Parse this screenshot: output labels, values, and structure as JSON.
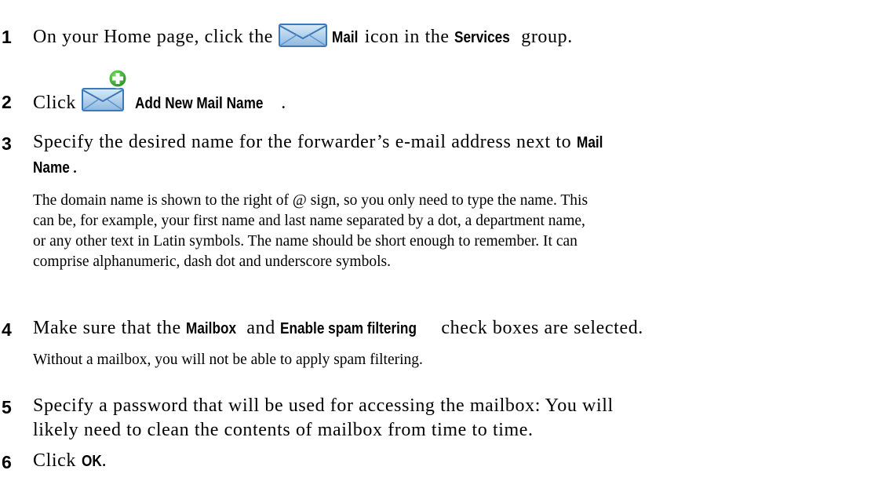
{
  "steps": [
    {
      "number": "1",
      "text_a": "On your Home page, click the",
      "ui_a": "Mail",
      "text_b": "icon in the",
      "ui_b": "Services",
      "text_c": "group."
    },
    {
      "number": "2",
      "text_a": "Click",
      "ui_a": "Add New Mail Name",
      "text_b": "."
    },
    {
      "number": "3",
      "text_a": "Specify the desired name for the forwarder’s e-mail address next to",
      "ui_a": "Mail",
      "ui_b": "Name",
      "text_b": ".",
      "note_lines": [
        "The domain name is shown to the right of @ sign, so you only need to type the name. This",
        "can be, for example, your first name and last name separated by a dot, a department name,",
        "or any other text in Latin symbols. The name should be short enough to remember. It can",
        "comprise alphanumeric, dash dot and underscore symbols."
      ]
    },
    {
      "number": "4",
      "text_a": "Make sure that the",
      "ui_a": "Mailbox",
      "text_b": "and",
      "ui_b": "Enable spam filtering",
      "text_c": "check boxes are selected.",
      "note": "Without a mailbox, you will not be able to apply spam filtering."
    },
    {
      "number": "5",
      "line_1": "Specify a password that will be used for accessing the mailbox: You will",
      "line_2": "likely need to clean the contents of mailbox from time to time."
    },
    {
      "number": "6",
      "text_a": "Click",
      "ui_a": "OK",
      "text_b": "."
    }
  ],
  "icons": {
    "mail": "mail-envelope-icon",
    "add_mail": "add-mail-name-icon"
  },
  "colors": {
    "envelope_fill": "#a9cbe8",
    "envelope_stroke": "#3d78b8",
    "plus_badge": "#2fa82f"
  }
}
